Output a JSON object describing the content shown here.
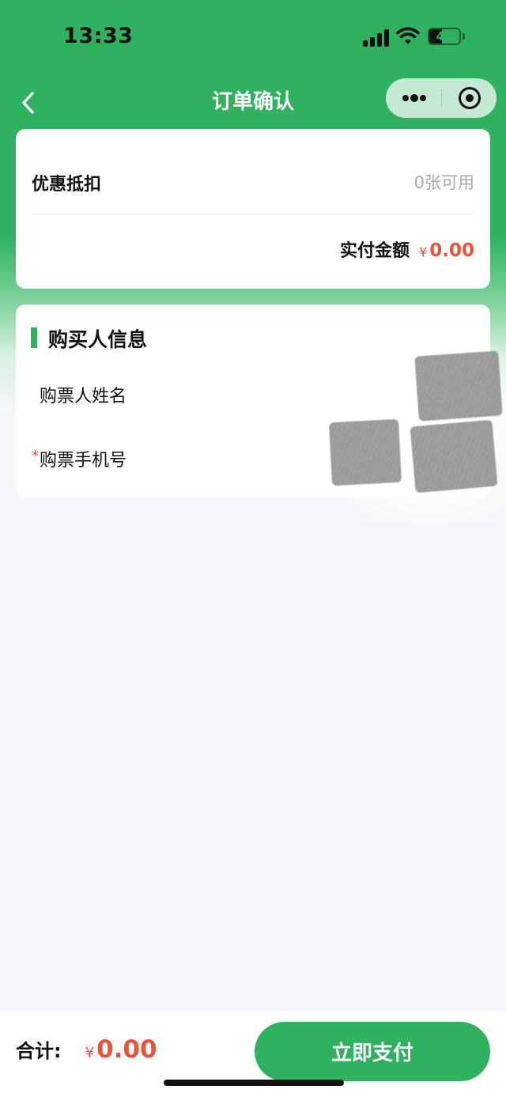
{
  "status_bar": {
    "time": "13:33",
    "battery_level": "41",
    "icons": [
      "signal-icon",
      "wifi-icon",
      "battery-icon"
    ]
  },
  "nav": {
    "title": "订单确认",
    "back_icon": "chevron-left-icon",
    "more_icon": "more-dots-icon",
    "close_icon": "target-close-icon"
  },
  "discount_card": {
    "discount_label": "优惠抵扣",
    "discount_value": "0张可用",
    "paid_label": "实付金额",
    "currency": "¥",
    "paid_amount": "0.00"
  },
  "buyer_card": {
    "title": "购买人信息",
    "fields": [
      {
        "label": "购票人姓名",
        "required": false,
        "value": ""
      },
      {
        "label": "购票手机号",
        "required": true,
        "required_mark": "*",
        "value": ""
      }
    ]
  },
  "bottom_bar": {
    "total_label": "合计:",
    "currency": "¥",
    "total_amount": "0.00",
    "pay_button": "立即支付"
  },
  "colors": {
    "brand_green": "#2fb15f",
    "price_red": "#e8543a",
    "muted_text": "#a9a9a9",
    "page_background": "#f5f7fa"
  }
}
